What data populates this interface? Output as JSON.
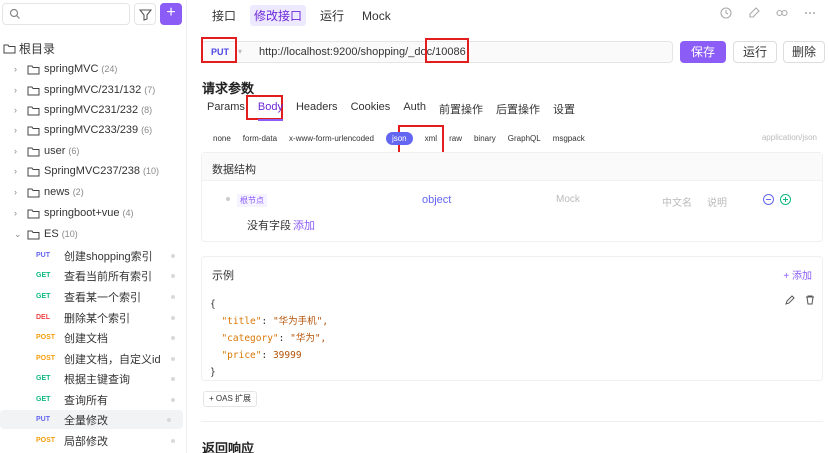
{
  "sidebar": {
    "search_placeholder": "",
    "root_label": "根目录",
    "folders": [
      {
        "name": "springMVC",
        "count": "(24)"
      },
      {
        "name": "springMVC/231/132",
        "count": "(7)"
      },
      {
        "name": "springMVC231/232",
        "count": "(8)"
      },
      {
        "name": "springMVC233/239",
        "count": "(6)"
      },
      {
        "name": "user",
        "count": "(6)"
      },
      {
        "name": "SpringMVC237/238",
        "count": "(10)"
      },
      {
        "name": "news",
        "count": "(2)"
      },
      {
        "name": "springboot+vue",
        "count": "(4)"
      },
      {
        "name": "ES",
        "count": "(10)"
      }
    ],
    "apis": [
      {
        "method": "PUT",
        "name": "创建shopping索引"
      },
      {
        "method": "GET",
        "name": "查看当前所有索引"
      },
      {
        "method": "GET",
        "name": "查看某一个索引"
      },
      {
        "method": "DEL",
        "name": "删除某个索引"
      },
      {
        "method": "POST",
        "name": "创建文档"
      },
      {
        "method": "POST",
        "name": "创建文档，自定义id"
      },
      {
        "method": "GET",
        "name": "根据主键查询"
      },
      {
        "method": "GET",
        "name": "查询所有"
      },
      {
        "method": "PUT",
        "name": "全量修改"
      },
      {
        "method": "POST",
        "name": "局部修改"
      }
    ]
  },
  "toptabs": [
    "接口",
    "修改接口",
    "运行",
    "Mock"
  ],
  "request": {
    "method": "PUT",
    "url": "http://localhost:9200/shopping/_doc/10086",
    "save": "保存",
    "run": "运行",
    "delete": "删除"
  },
  "params": {
    "title": "请求参数",
    "tabs": [
      "Params",
      "Body",
      "Headers",
      "Cookies",
      "Auth",
      "前置操作",
      "后置操作",
      "设置"
    ],
    "body_types": [
      "none",
      "form-data",
      "x-www-form-urlencoded",
      "json",
      "xml",
      "raw",
      "binary",
      "GraphQL",
      "msgpack"
    ],
    "content_type": "application/json"
  },
  "schema": {
    "title": "数据结构",
    "node": "根节点",
    "type": "object",
    "mock": "Mock",
    "cn_name": "中文名",
    "desc": "说明",
    "no_field": "没有字段",
    "add": "添加"
  },
  "example": {
    "title": "示例",
    "add": "+ 添加",
    "open": "{",
    "close": "}",
    "lines": [
      {
        "key": "\"title\"",
        "value": "\"华为手机\","
      },
      {
        "key": "\"category\"",
        "value": "\"华为\","
      },
      {
        "key": "\"price\"",
        "value": "39999"
      }
    ]
  },
  "oas": "+ OAS 扩展",
  "response_title": "返回响应"
}
